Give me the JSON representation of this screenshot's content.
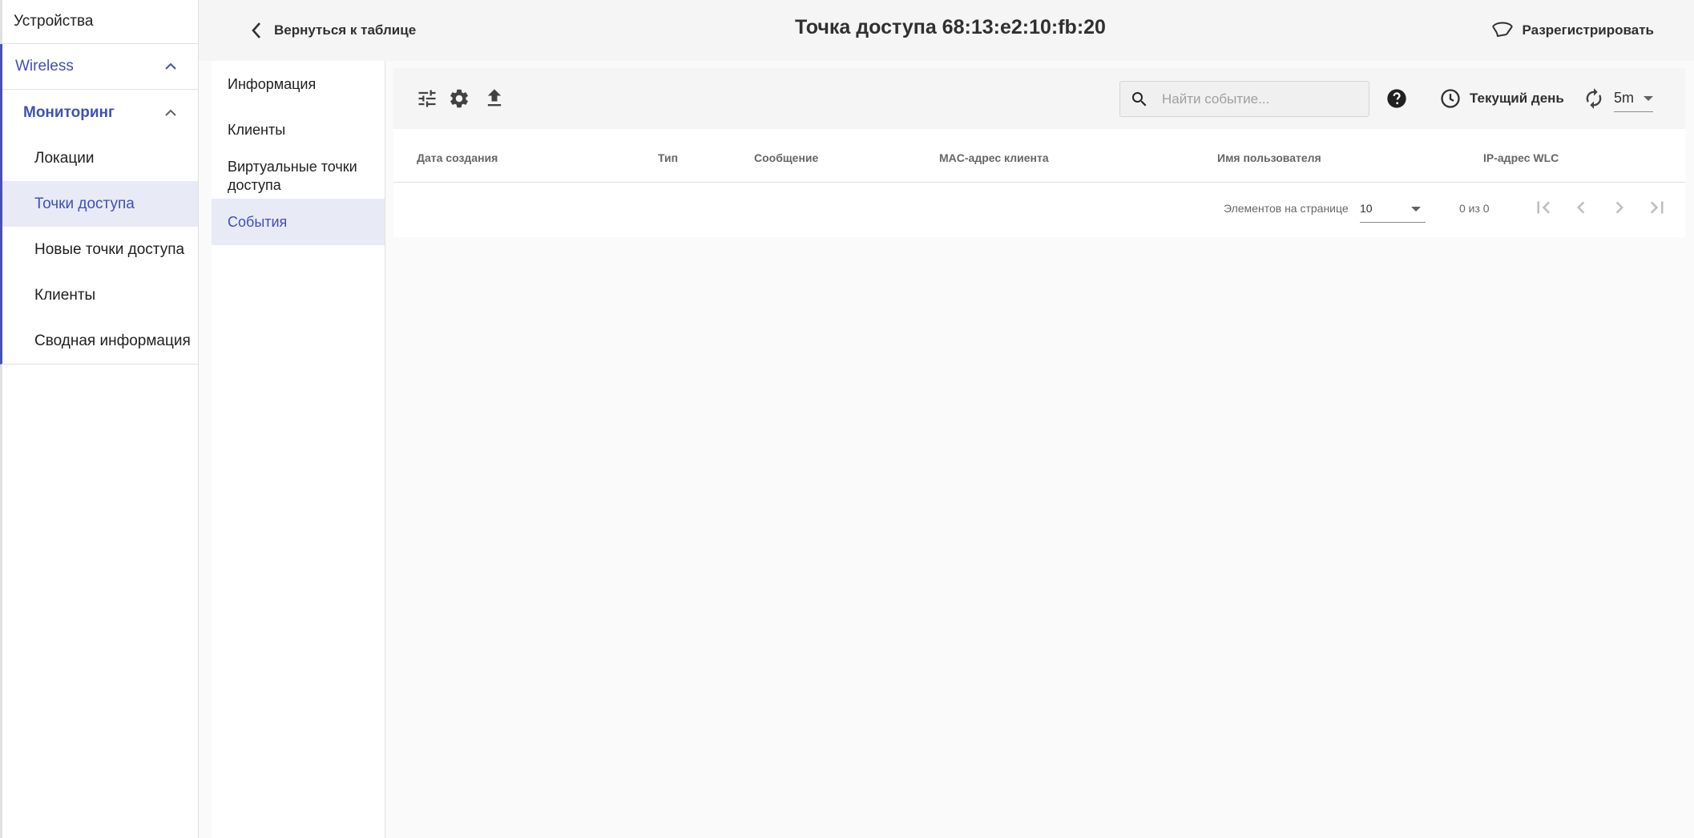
{
  "sidebar": {
    "top_item": "Устройства",
    "wireless": "Wireless",
    "monitoring": "Мониторинг",
    "items": [
      "Локации",
      "Точки доступа",
      "Новые точки доступа",
      "Клиенты",
      "Сводная информация"
    ],
    "active_item": "Точки доступа"
  },
  "header": {
    "back_label": "Вернуться к таблице",
    "title": "Точка доступа 68:13:e2:10:fb:20",
    "unregister_label": "Разрегистрировать"
  },
  "subnav": {
    "items": [
      "Информация",
      "Клиенты",
      "Виртуальные точки доступа",
      "События"
    ],
    "active_item": "События"
  },
  "toolbar": {
    "icons": [
      "tune-icon",
      "settings-gear-icon",
      "upload-icon"
    ],
    "search_placeholder": "Найти событие...",
    "search_value": "",
    "period_label": "Текущий день",
    "refresh_interval": "5m"
  },
  "table": {
    "columns": [
      "Дата создания",
      "Тип",
      "Сообщение",
      "MAC-адрес клиента",
      "Имя пользователя",
      "IP-адрес WLC"
    ],
    "rows": []
  },
  "paginator": {
    "page_size_label": "Элементов на странице",
    "page_size": "10",
    "range_label": "0 из 0"
  },
  "colors": {
    "accent": "#3f51b5",
    "active_bg": "#e8eaf6",
    "header_bg": "#f5f5f5",
    "icon": "#424242"
  }
}
